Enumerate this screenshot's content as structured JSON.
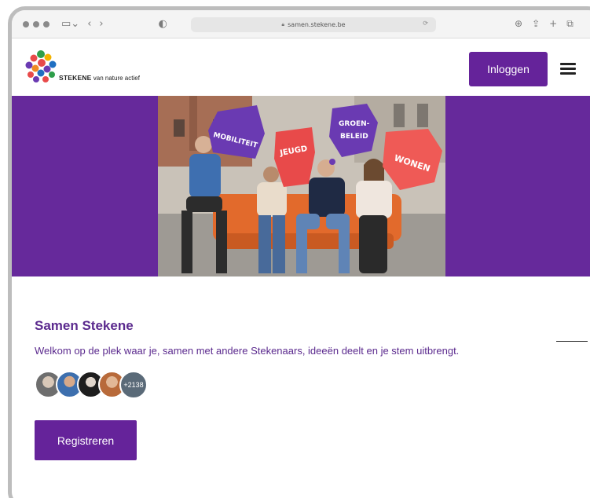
{
  "browser": {
    "url": "samen.stekene.be",
    "icons": [
      "back-icon",
      "forward-icon",
      "sidebar-icon",
      "shield-icon",
      "reload-icon",
      "download-icon",
      "share-icon",
      "new-tab-icon",
      "tabs-icon"
    ]
  },
  "header": {
    "brand_name": "STEKENE",
    "brand_tagline": "van nature actief",
    "login_label": "Inloggen",
    "menu_icon": "hamburger-menu-icon"
  },
  "hero": {
    "signs": [
      "MOBILITEIT",
      "JEUGD",
      "GROEN-",
      "BELEID",
      "WONEN"
    ],
    "sign_colors": [
      "#6a3ab2",
      "#e84a4a",
      "#6a3ab2",
      "#ef5a56"
    ]
  },
  "intro": {
    "title": "Samen Stekene",
    "subtitle": "Welkom op de plek waar je, samen met andere Stekenaars, ideeën deelt en je stem uitbrengt.",
    "participants_more": "+2138",
    "register_label": "Registreren"
  },
  "colors": {
    "brand_purple": "#65239a",
    "hero_purple": "#66299b",
    "text_purple": "#5b2a8e"
  }
}
